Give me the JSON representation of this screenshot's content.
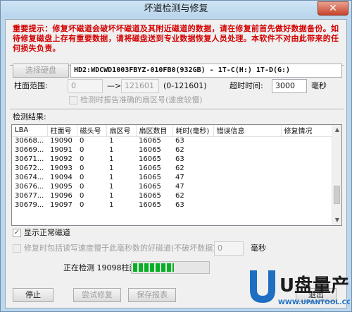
{
  "window": {
    "title": "坏道检测与修复",
    "close_label": "✕"
  },
  "warning": "重要提示：修复坏磁道会破坏坏磁道及其附近磁道的数据，请在修复前首先做好数据备份。如待修复磁盘上存有重要数据，请将磁盘送到专业数据恢复人员处理。本软件不对由此带来的任何损失负责。",
  "disk": {
    "select_label": "选择硬盘",
    "info": "HD2:WDCWD1003FBYZ-010FB0(932GB) - 1T-C(H:) 1T-D(G:)"
  },
  "range": {
    "label": "柱面范围:",
    "start": "0",
    "arrow": "—>",
    "end": "121601",
    "hint": "(0-121601)",
    "timeout_label": "超时时间:",
    "timeout": "3000",
    "unit": "毫秒"
  },
  "report_sector_label": "检测时报告准确的扇区号(速度较慢)",
  "results": {
    "label": "检测结果:",
    "columns": [
      "LBA",
      "柱面号",
      "磁头号",
      "扇区号",
      "扇区数目",
      "耗时(毫秒)",
      "错误信息",
      "修复情况"
    ],
    "rows": [
      [
        "30668...",
        "19090",
        "0",
        "1",
        "16065",
        "63",
        "",
        ""
      ],
      [
        "30669...",
        "19091",
        "0",
        "1",
        "16065",
        "62",
        "",
        ""
      ],
      [
        "30671...",
        "19092",
        "0",
        "1",
        "16065",
        "63",
        "",
        ""
      ],
      [
        "30672...",
        "19093",
        "0",
        "1",
        "16065",
        "62",
        "",
        ""
      ],
      [
        "30674...",
        "19094",
        "0",
        "1",
        "16065",
        "47",
        "",
        ""
      ],
      [
        "30676...",
        "19095",
        "0",
        "1",
        "16065",
        "47",
        "",
        ""
      ],
      [
        "30677...",
        "19096",
        "0",
        "1",
        "16065",
        "62",
        "",
        ""
      ],
      [
        "30679...",
        "19097",
        "0",
        "1",
        "16065",
        "63",
        "",
        ""
      ]
    ]
  },
  "show_normal": {
    "label": "显示正常磁道",
    "checked": true
  },
  "repair_slow": {
    "label": "修复时包括读写速度慢于此毫秒数的好磁道(不破坏数据):",
    "value": "0",
    "unit": "毫秒"
  },
  "status": {
    "text": "正在检测 19098柱面",
    "progress_percent": 55
  },
  "buttons": {
    "stop": "停止",
    "try_repair": "尝试修复",
    "save_report": "保存报表",
    "exit": "退出"
  },
  "watermark": {
    "brand": "U盘量产网",
    "url": "WWW.UPANTOOL.COM"
  },
  "colors": {
    "warning": "#d40000",
    "progress": "#06b025",
    "title_bg": "#bcd8ee"
  }
}
